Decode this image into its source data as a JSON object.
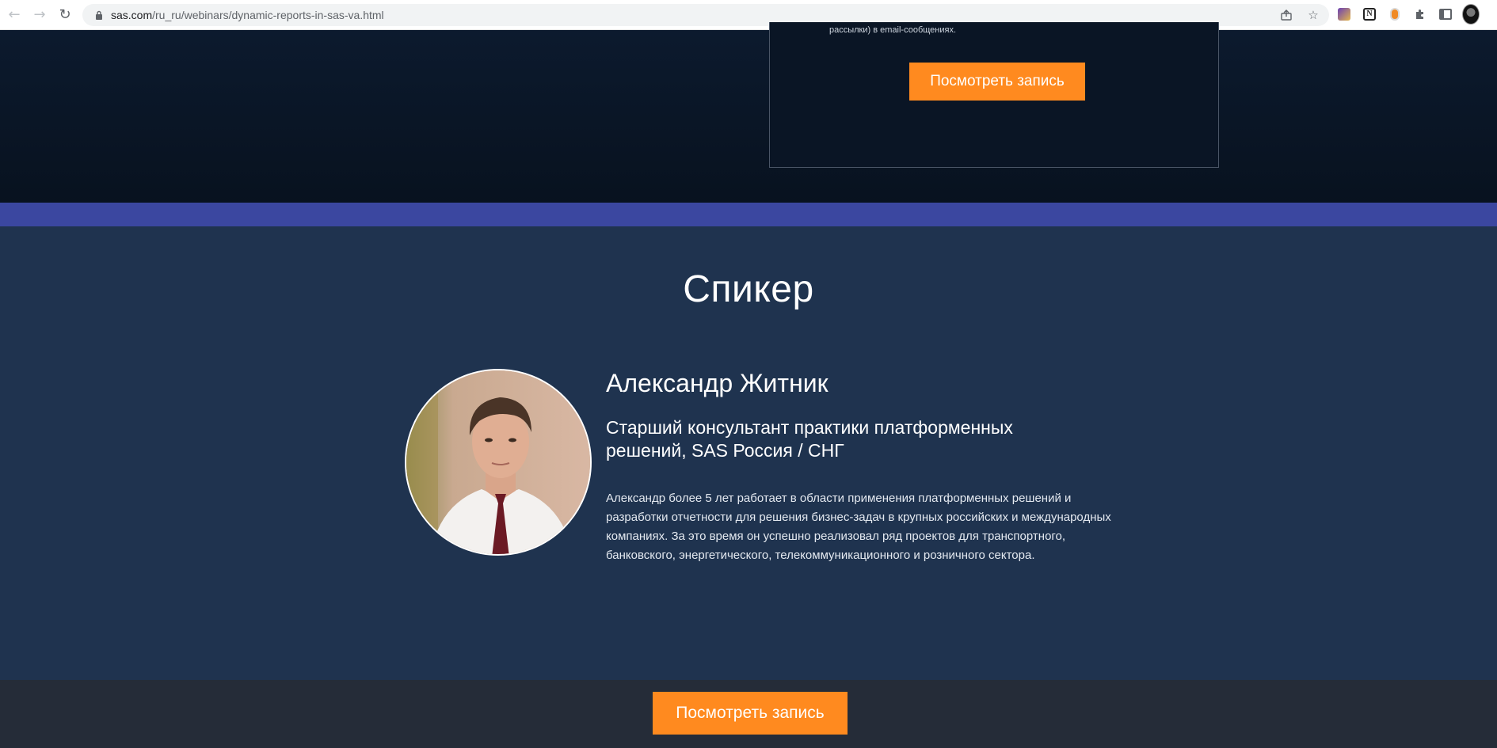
{
  "browser": {
    "url_host": "sas.com",
    "url_path": "/ru_ru/webinars/dynamic-reports-in-sas-va.html",
    "back_icon": "arrow-left-icon",
    "forward_icon": "arrow-right-icon",
    "reload_icon": "reload-icon",
    "extensions": [
      "extension-1-icon",
      "notion-icon",
      "extension-3-icon",
      "puzzle-icon",
      "sidebar-icon",
      "profile-avatar"
    ]
  },
  "hero": {
    "form_note": "рассылки) в email-сообщениях.",
    "watch_button": "Посмотреть запись"
  },
  "speaker_section": {
    "heading": "Спикер",
    "name": "Александр Житник",
    "role": "Старший консультант практики платформенных решений, SAS Россия / СНГ",
    "bio": "Александр более 5 лет работает в области применения платформенных решений и разработки отчетности для решения бизнес-задач в крупных российских и международных компаниях. За это время он успешно реализовал ряд проектов для транспортного, банковского, энергетического, телекоммуникационного и розничного сектора."
  },
  "footer_cta": {
    "watch_button": "Посмотреть запись"
  },
  "colors": {
    "accent_orange": "#ff8a1f",
    "stripe": "#3b47a0",
    "speaker_bg": "#1f334f",
    "hero_bg": "#0a1424",
    "cta_bar_bg": "#252c38"
  }
}
